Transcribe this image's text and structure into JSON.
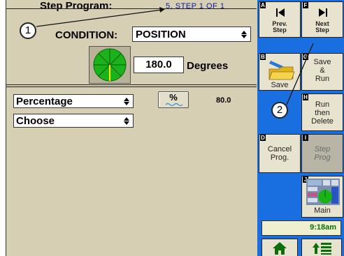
{
  "header": {
    "title": "Step Program:",
    "step_info": "5, STEP  1  OF  1"
  },
  "condition": {
    "label": "CONDITION:",
    "selected": "POSITION",
    "value": "180.0",
    "unit": "Degrees"
  },
  "lower": {
    "mode_selected": "Percentage",
    "percent_button": "%",
    "percent_value": "80.0",
    "choose_selected": "Choose"
  },
  "buttons": [
    {
      "key": "A",
      "label_lines": [
        "Prev.",
        "Step"
      ],
      "icon": "skip-back-icon"
    },
    {
      "key": "F",
      "label_lines": [
        "Next",
        "Step"
      ],
      "icon": "skip-forward-icon"
    },
    {
      "key": "B",
      "label_lines": [
        "Save"
      ],
      "icon": "folder-save-icon"
    },
    {
      "key": "G",
      "label_lines": [
        "Save",
        "&",
        "Run"
      ]
    },
    {
      "key": "H",
      "label_lines": [
        "Run",
        "then",
        "Delete"
      ]
    },
    {
      "key": "D",
      "label_lines": [
        "Cancel",
        "Prog."
      ]
    },
    {
      "key": "I",
      "label_lines": [
        "Step",
        "Prog"
      ],
      "disabled": true
    },
    {
      "key": "J",
      "label_lines": [
        "Main"
      ],
      "icon": "main-screen-icon"
    }
  ],
  "status": {
    "time": "9:18am"
  },
  "nav": {
    "home_icon": "home-icon",
    "list_icon": "list-up-icon"
  },
  "callouts": [
    "1",
    "2"
  ],
  "colors": {
    "panel_bg": "#d6cfb4",
    "sidebar_bg": "#1a6fe0",
    "step_info_text": "#0a1a9a",
    "dial_green": "#1bb21b",
    "clock_text": "#0b6e0b"
  }
}
